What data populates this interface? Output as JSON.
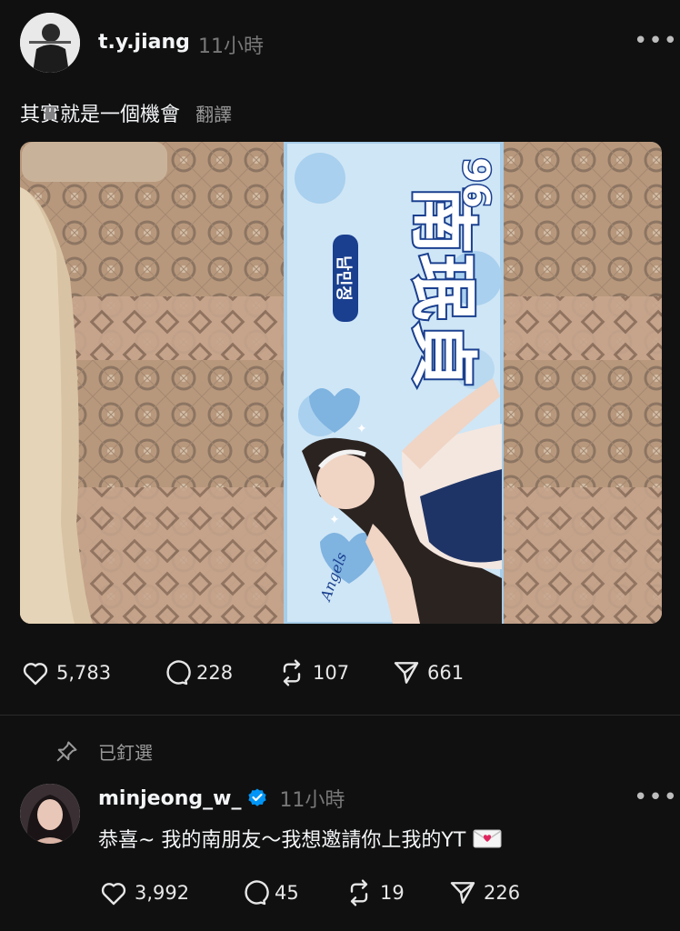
{
  "post": {
    "username": "t.y.jiang",
    "time": "11小時",
    "text": "其實就是一個機會",
    "translate_label": "翻譯",
    "banner_name": "南珉貞",
    "banner_korean": "남민정",
    "banner_number": "96",
    "banner_signature": "Angels",
    "actions": {
      "likes": "5,783",
      "comments": "228",
      "reposts": "107",
      "shares": "661"
    }
  },
  "pinned_label": "已釘選",
  "reply": {
    "username": "minjeong_w_",
    "time": "11小時",
    "text": "恭喜~ 我的南朋友～我想邀請你上我的YT",
    "actions": {
      "likes": "3,992",
      "comments": "45",
      "reposts": "19",
      "shares": "226"
    }
  },
  "colors": {
    "background": "#101010",
    "text": "#f3f5f7",
    "muted": "#777777",
    "verified": "#0095f6",
    "banner": "#cfe6f6",
    "banner_text": "#1a3f8f"
  }
}
